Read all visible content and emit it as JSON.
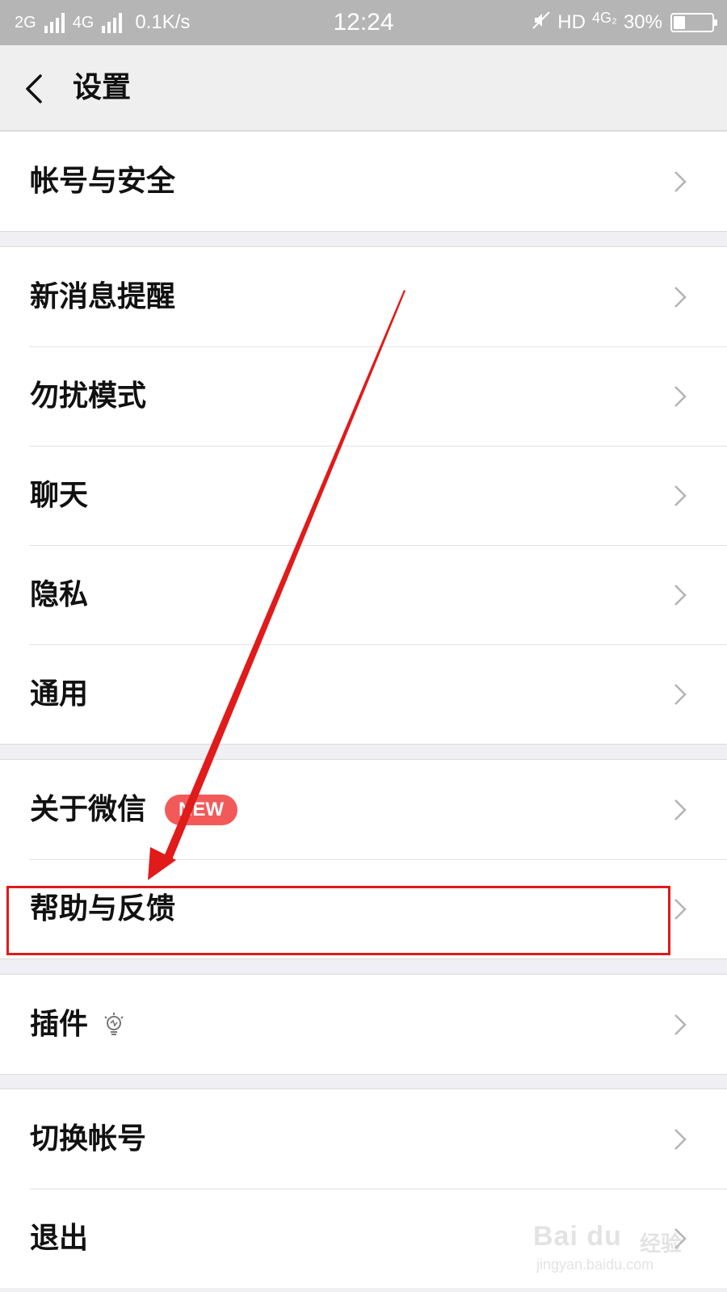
{
  "status_bar": {
    "net1": "2G",
    "net2": "4G",
    "speed": "0.1K/s",
    "time": "12:24",
    "hd": "HD",
    "net3": "4G₂",
    "battery": "30%",
    "battery_level": 0.3
  },
  "header": {
    "back_icon": "chevron-left-icon",
    "title": "设置"
  },
  "groups": [
    {
      "items": [
        {
          "label": "帐号与安全"
        }
      ]
    },
    {
      "items": [
        {
          "label": "新消息提醒"
        },
        {
          "label": "勿扰模式"
        },
        {
          "label": "聊天"
        },
        {
          "label": "隐私"
        },
        {
          "label": "通用"
        }
      ]
    },
    {
      "items": [
        {
          "label": "关于微信",
          "badge": "NEW"
        },
        {
          "label": "帮助与反馈"
        }
      ]
    },
    {
      "items": [
        {
          "label": "插件",
          "icon": "lightbulb-icon"
        }
      ]
    },
    {
      "items": [
        {
          "label": "切换帐号"
        },
        {
          "label": "退出"
        }
      ]
    }
  ],
  "annotation": {
    "highlighted_item": "帮助与反馈",
    "color": "#e11a1a"
  },
  "watermark": {
    "logo": "Bai du",
    "jingyan": "经验",
    "url": "jingyan.baidu.com"
  },
  "colors": {
    "background": "#efeff4",
    "status_bar": "#b5b5b5",
    "header": "#efefef",
    "badge": "#f25a5a"
  }
}
